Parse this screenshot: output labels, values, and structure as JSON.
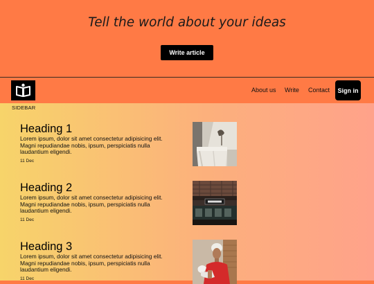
{
  "hero": {
    "title": "Tell the world about your ideas",
    "write_button": "Write article"
  },
  "nav": {
    "logo_icon": "open-book-icon",
    "links": [
      "About us",
      "Write",
      "Contact"
    ],
    "signin": "Sign in"
  },
  "sidebar": {
    "label": "SIDEBAR"
  },
  "articles": [
    {
      "heading": "Heading 1",
      "body": "Lorem ipsum, dolor sit amet consectetur adipisicing elit. Magni repudiandae nobis, ipsum, perspiciatis nulla laudantium eligendi.",
      "date": "11 Dec",
      "image": "room-with-table-photo"
    },
    {
      "heading": "Heading 2",
      "body": "Lorem ipsum, dolor sit amet consectetur adipisicing elit. Magni repudiandae nobis, ipsum, perspiciatis nulla laudantium eligendi.",
      "date": "11 Dec",
      "image": "subway-station-photo"
    },
    {
      "heading": "Heading 3",
      "body": "Lorem ipsum, dolor sit amet consectetur adipisicing elit. Magni repudiandae nobis, ipsum, perspiciatis nulla laudantium eligendi.",
      "date": "11 Dec",
      "image": "woman-with-flowers-photo"
    }
  ],
  "colors": {
    "accent": "#ff7a45",
    "gradient_start": "#f7d46a",
    "gradient_end": "#ffa28a"
  }
}
